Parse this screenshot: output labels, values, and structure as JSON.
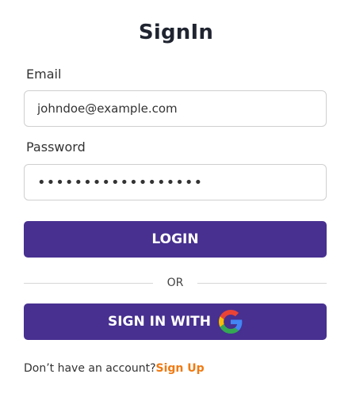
{
  "form": {
    "title": "SignIn",
    "email": {
      "label": "Email",
      "value": "johndoe@example.com",
      "placeholder": ""
    },
    "password": {
      "label": "Password",
      "value": "••••••••••••••••••"
    },
    "login_label": "LOGIN",
    "divider_text": "OR",
    "google_label": "SIGN IN WITH",
    "google_icon": "google-icon",
    "footer_text": "Don’t have an account?",
    "signup_link": "Sign Up"
  },
  "colors": {
    "primary": "#473090",
    "link": "#f07a12",
    "title": "#1f2430"
  }
}
